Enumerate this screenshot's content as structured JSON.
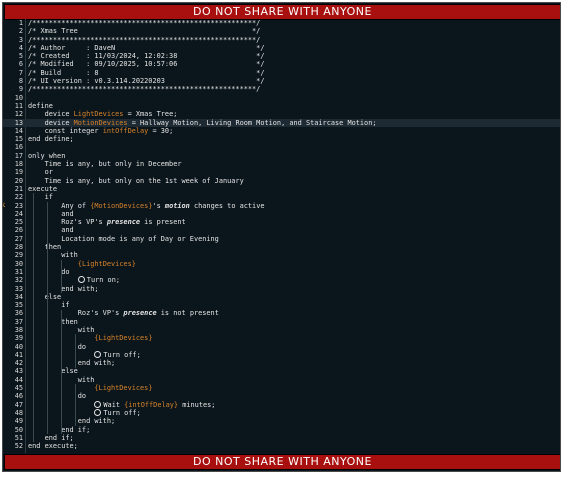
{
  "banner": {
    "top": "DO NOT SHARE WITH ANYONE",
    "bottom": "DO NOT SHARE WITH ANYONE"
  },
  "colors": {
    "background": "#0b161c",
    "banner": "#a80f0f",
    "variable": "#d7822a",
    "text": "#e4e4e4"
  },
  "lines": [
    {
      "n": "1",
      "segs": [
        {
          "t": "/******************************************************/"
        }
      ]
    },
    {
      "n": "2",
      "segs": [
        {
          "t": "/* Xmas Tree                                          */"
        }
      ]
    },
    {
      "n": "3",
      "segs": [
        {
          "t": "/******************************************************/"
        }
      ]
    },
    {
      "n": "4",
      "segs": [
        {
          "t": "/* Author     : DaveN                                  */"
        }
      ]
    },
    {
      "n": "5",
      "segs": [
        {
          "t": "/* Created    : 11/03/2024, 12:02:38                   */"
        }
      ]
    },
    {
      "n": "6",
      "segs": [
        {
          "t": "/* Modified   : 09/10/2025, 10:57:06                   */"
        }
      ]
    },
    {
      "n": "7",
      "segs": [
        {
          "t": "/* Build      : 8                                      */"
        }
      ]
    },
    {
      "n": "8",
      "segs": [
        {
          "t": "/* UI version : v0.3.114.20220203                      */"
        }
      ]
    },
    {
      "n": "9",
      "segs": [
        {
          "t": "/******************************************************/"
        }
      ]
    },
    {
      "n": "10",
      "segs": []
    },
    {
      "n": "11",
      "segs": [
        {
          "t": "define"
        }
      ]
    },
    {
      "n": "12",
      "segs": [
        {
          "t": "    device "
        },
        {
          "t": "LightDevices",
          "c": "var"
        },
        {
          "t": " = Xmas Tree;"
        }
      ]
    },
    {
      "n": "13",
      "hl": true,
      "segs": [
        {
          "t": "    device "
        },
        {
          "t": "MotionDevices",
          "c": "var"
        },
        {
          "t": " = Hallway Motion, Living Room Motion, and Staircase Motion;"
        }
      ]
    },
    {
      "n": "14",
      "segs": [
        {
          "t": "    const integer "
        },
        {
          "t": "intOffDelay",
          "c": "var"
        },
        {
          "t": " = 30;"
        }
      ]
    },
    {
      "n": "15",
      "segs": [
        {
          "t": "end define;"
        }
      ]
    },
    {
      "n": "16",
      "segs": []
    },
    {
      "n": "17",
      "segs": [
        {
          "t": "only when"
        }
      ]
    },
    {
      "n": "18",
      "segs": [
        {
          "t": "    Time is any, but only in December"
        }
      ]
    },
    {
      "n": "19",
      "segs": [
        {
          "t": "    or"
        }
      ]
    },
    {
      "n": "20",
      "segs": [
        {
          "t": "    Time is any, but only on the 1st week of January"
        }
      ]
    },
    {
      "n": "21",
      "segs": [
        {
          "t": "execute"
        }
      ]
    },
    {
      "n": "22",
      "segs": [
        {
          "t": "    if"
        }
      ]
    },
    {
      "n": "23",
      "marker": true,
      "segs": [
        {
          "t": "        Any of "
        },
        {
          "t": "{MotionDevices}",
          "c": "var"
        },
        {
          "t": "'s "
        },
        {
          "t": "motion",
          "c": "em"
        },
        {
          "t": " changes to active"
        }
      ]
    },
    {
      "n": "24",
      "segs": [
        {
          "t": "        and"
        }
      ]
    },
    {
      "n": "25",
      "segs": [
        {
          "t": "        Roz's VP's "
        },
        {
          "t": "presence",
          "c": "em"
        },
        {
          "t": " is present"
        }
      ]
    },
    {
      "n": "26",
      "segs": [
        {
          "t": "        and"
        }
      ]
    },
    {
      "n": "27",
      "segs": [
        {
          "t": "        Location mode is any of Day or Evening"
        }
      ]
    },
    {
      "n": "28",
      "segs": [
        {
          "t": "    then"
        }
      ]
    },
    {
      "n": "29",
      "segs": [
        {
          "t": "        with"
        }
      ]
    },
    {
      "n": "30",
      "segs": [
        {
          "t": "            "
        },
        {
          "t": "{LightDevices}",
          "c": "var"
        }
      ]
    },
    {
      "n": "31",
      "segs": [
        {
          "t": "        do"
        }
      ]
    },
    {
      "n": "32",
      "segs": [
        {
          "t": "            "
        },
        {
          "t": "",
          "icon": true
        },
        {
          "t": "Turn on;"
        }
      ]
    },
    {
      "n": "33",
      "segs": [
        {
          "t": "        end with;"
        }
      ]
    },
    {
      "n": "34",
      "segs": [
        {
          "t": "    else"
        }
      ]
    },
    {
      "n": "35",
      "segs": [
        {
          "t": "        if"
        }
      ]
    },
    {
      "n": "36",
      "segs": [
        {
          "t": "            Roz's VP's "
        },
        {
          "t": "presence",
          "c": "em"
        },
        {
          "t": " is not present"
        }
      ]
    },
    {
      "n": "37",
      "segs": [
        {
          "t": "        then"
        }
      ]
    },
    {
      "n": "38",
      "segs": [
        {
          "t": "            with"
        }
      ]
    },
    {
      "n": "39",
      "segs": [
        {
          "t": "                "
        },
        {
          "t": "{LightDevices}",
          "c": "var"
        }
      ]
    },
    {
      "n": "40",
      "segs": [
        {
          "t": "            do"
        }
      ]
    },
    {
      "n": "41",
      "segs": [
        {
          "t": "                "
        },
        {
          "t": "",
          "icon": true
        },
        {
          "t": "Turn off;"
        }
      ]
    },
    {
      "n": "42",
      "segs": [
        {
          "t": "            end with;"
        }
      ]
    },
    {
      "n": "43",
      "segs": [
        {
          "t": "        else"
        }
      ]
    },
    {
      "n": "44",
      "segs": [
        {
          "t": "            with"
        }
      ]
    },
    {
      "n": "45",
      "segs": [
        {
          "t": "                "
        },
        {
          "t": "{LightDevices}",
          "c": "var"
        }
      ]
    },
    {
      "n": "46",
      "segs": [
        {
          "t": "            do"
        }
      ]
    },
    {
      "n": "47",
      "segs": [
        {
          "t": "                "
        },
        {
          "t": "",
          "icon": true
        },
        {
          "t": "Wait "
        },
        {
          "t": "{intOffDelay}",
          "c": "var"
        },
        {
          "t": " minutes;"
        }
      ]
    },
    {
      "n": "48",
      "segs": [
        {
          "t": "                "
        },
        {
          "t": "",
          "icon": true
        },
        {
          "t": "Turn off;"
        }
      ]
    },
    {
      "n": "49",
      "segs": [
        {
          "t": "            end with;"
        }
      ]
    },
    {
      "n": "50",
      "segs": [
        {
          "t": "        end if;"
        }
      ]
    },
    {
      "n": "51",
      "segs": [
        {
          "t": "    end if;"
        }
      ]
    },
    {
      "n": "52",
      "segs": [
        {
          "t": "end execute;"
        }
      ]
    }
  ]
}
